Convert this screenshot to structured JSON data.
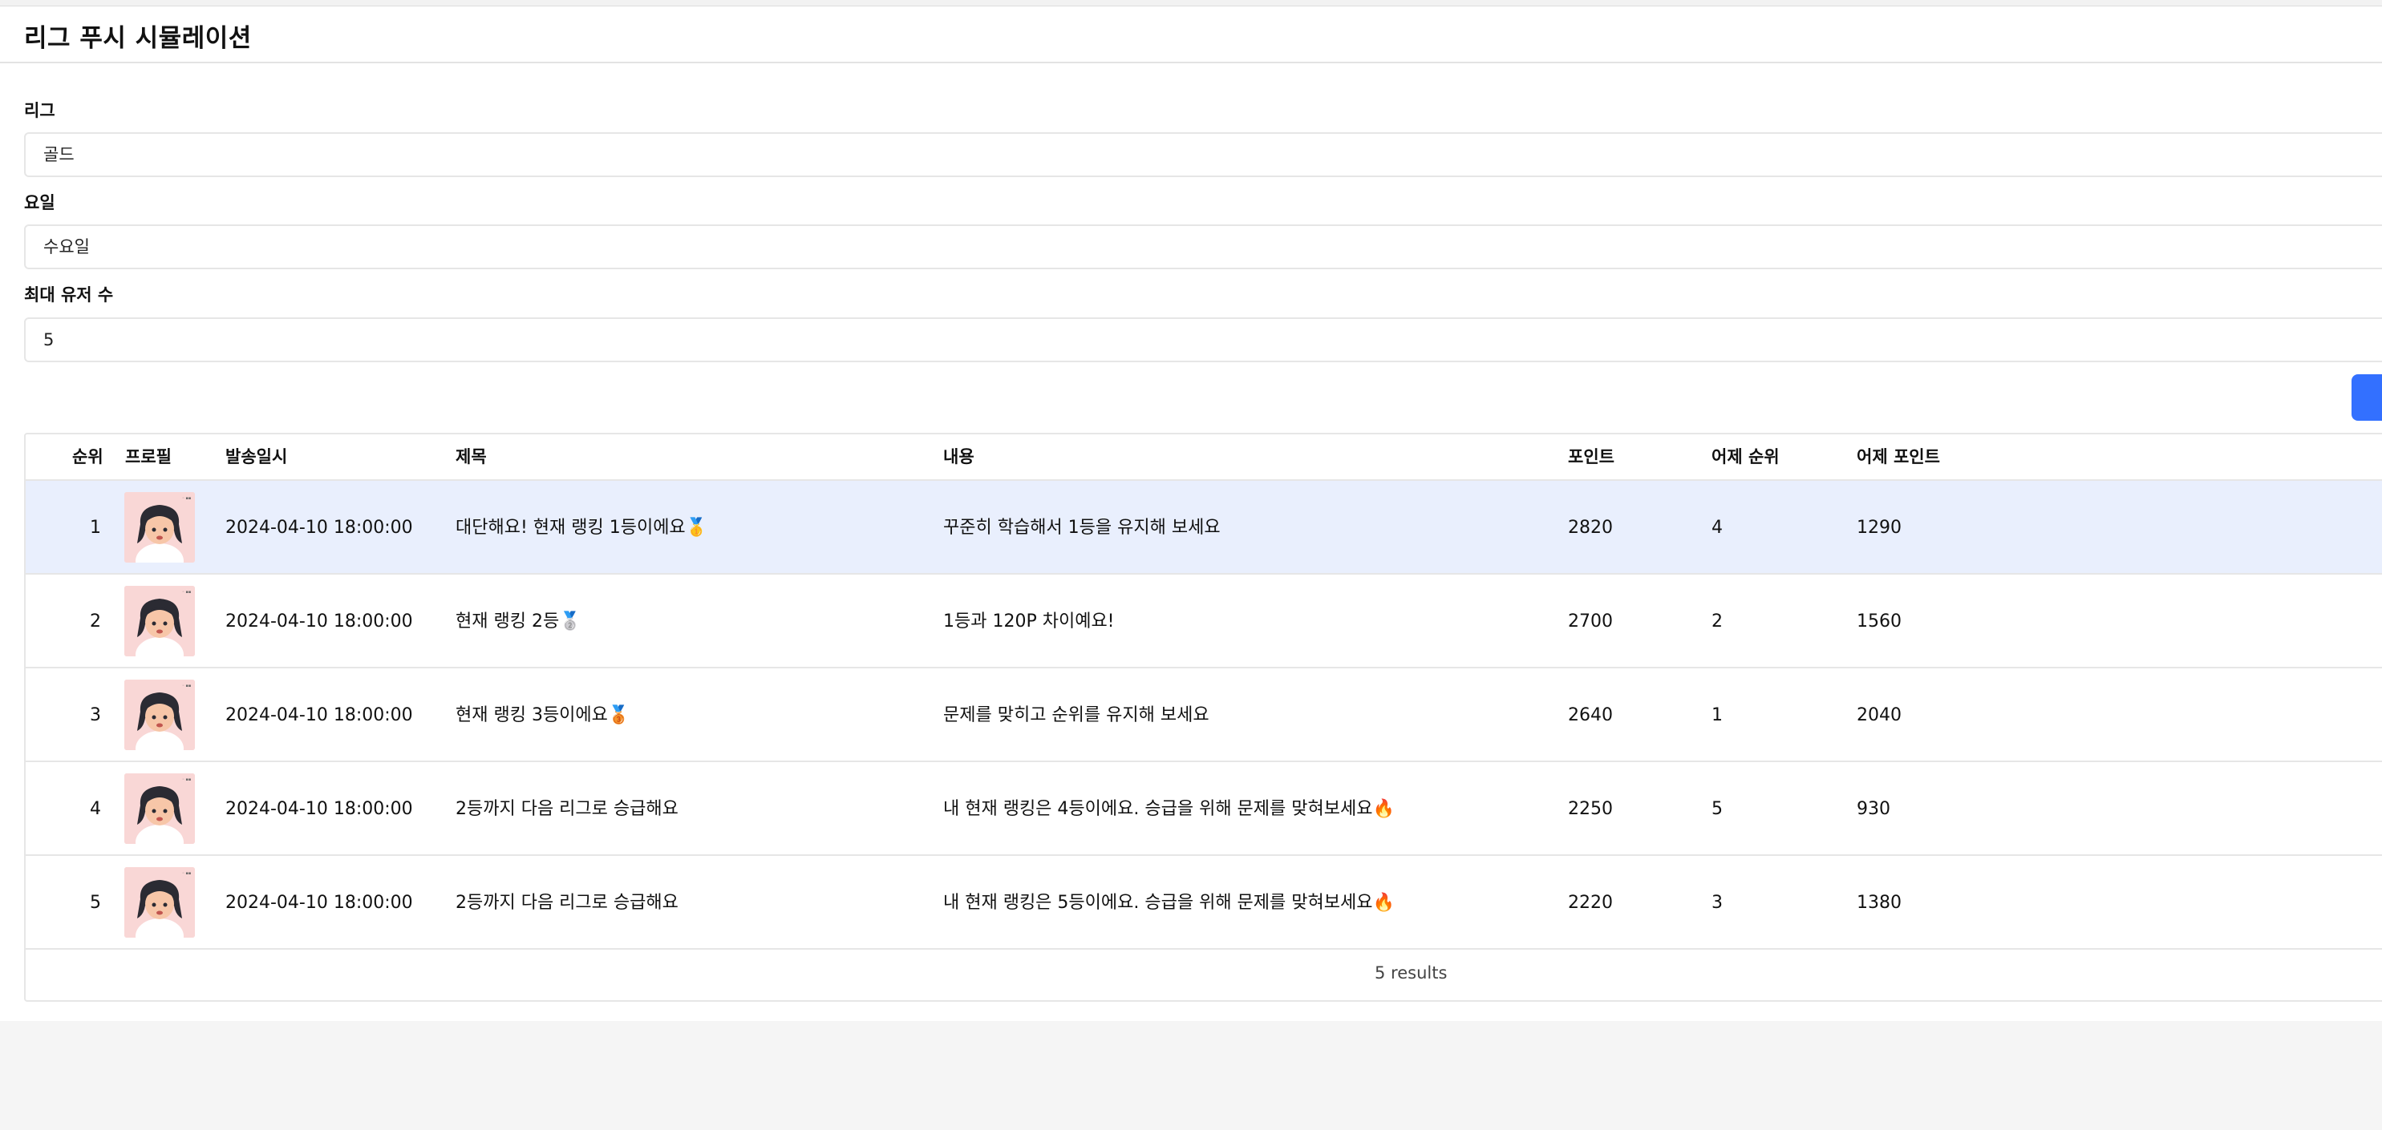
{
  "page": {
    "title": "리그 푸시 시뮬레이션"
  },
  "form": {
    "league_label": "리그",
    "league_value": "골드",
    "day_label": "요일",
    "day_value": "수요일",
    "max_users_label": "최대 유저 수",
    "max_users_value": "5"
  },
  "table": {
    "headers": [
      "순위",
      "프로필",
      "발송일시",
      "제목",
      "내용",
      "포인트",
      "어제 순위",
      "어제 포인트"
    ],
    "rows": [
      {
        "rank": "1",
        "sent_at": "2024-04-10 18:00:00",
        "title": "대단해요! 현재 랭킹 1등이에요🥇",
        "content": "꾸준히 학습해서 1등을 유지해 보세요",
        "points": "2820",
        "yesterday_rank": "4",
        "yesterday_points": "1290"
      },
      {
        "rank": "2",
        "sent_at": "2024-04-10 18:00:00",
        "title": "현재 랭킹 2등🥈",
        "content": "1등과 120P 차이예요!",
        "points": "2700",
        "yesterday_rank": "2",
        "yesterday_points": "1560"
      },
      {
        "rank": "3",
        "sent_at": "2024-04-10 18:00:00",
        "title": "현재 랭킹 3등이에요🥉",
        "content": "문제를 맞히고 순위를 유지해 보세요",
        "points": "2640",
        "yesterday_rank": "1",
        "yesterday_points": "2040"
      },
      {
        "rank": "4",
        "sent_at": "2024-04-10 18:00:00",
        "title": "2등까지 다음 리그로 승급해요",
        "content": "내 현재 랭킹은 4등이에요. 승급을 위해 문제를 맞혀보세요🔥",
        "points": "2250",
        "yesterday_rank": "5",
        "yesterday_points": "930"
      },
      {
        "rank": "5",
        "sent_at": "2024-04-10 18:00:00",
        "title": "2등까지 다음 리그로 승급해요",
        "content": "내 현재 랭킹은 5등이에요. 승급을 위해 문제를 맞혀보세요🔥",
        "points": "2220",
        "yesterday_rank": "3",
        "yesterday_points": "1380"
      }
    ],
    "footer": "5 results"
  },
  "colors": {
    "accent": "#3370ff",
    "selected_row": "#e9effd",
    "avatar_bg": "#f9d7d6"
  },
  "icons": {
    "profile": "cartoon-girl-avatar"
  }
}
